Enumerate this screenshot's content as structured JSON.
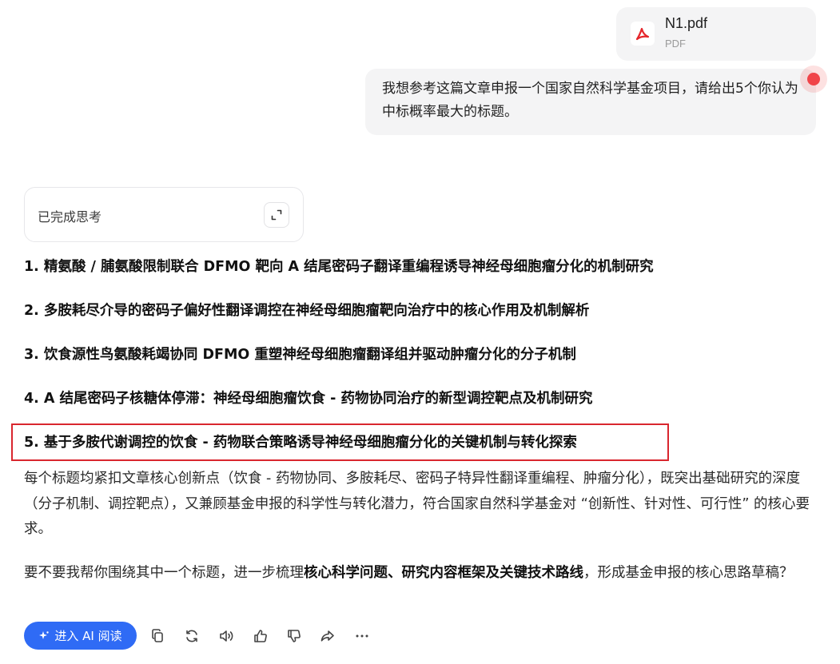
{
  "attachment": {
    "name": "N1.pdf",
    "type": "PDF",
    "icon": "pdf-icon",
    "icon_color": "#e5252a"
  },
  "user_message": {
    "text": "我想参考这篇文章申报一个国家自然科学基金项目，请给出5个你认为中标概率最大的标题。"
  },
  "thinking": {
    "label": "已完成思考",
    "expand_icon": "expand-icon"
  },
  "titles": [
    "1. 精氨酸 / 脯氨酸限制联合 DFMO 靶向 A 结尾密码子翻译重编程诱导神经母细胞瘤分化的机制研究",
    "2. 多胺耗尽介导的密码子偏好性翻译调控在神经母细胞瘤靶向治疗中的核心作用及机制解析",
    "3. 饮食源性鸟氨酸耗竭协同 DFMO 重塑神经母细胞瘤翻译组并驱动肿瘤分化的分子机制",
    "4. A 结尾密码子核糖体停滞：神经母细胞瘤饮食 - 药物协同治疗的新型调控靶点及机制研究",
    "5. 基于多胺代谢调控的饮食 - 药物联合策略诱导神经母细胞瘤分化的关键机制与转化探索"
  ],
  "summary": "每个标题均紧扣文章核心创新点（饮食 - 药物协同、多胺耗尽、密码子特异性翻译重编程、肿瘤分化），既突出基础研究的深度（分子机制、调控靶点），又兼顾基金申报的科学性与转化潜力，符合国家自然科学基金对 “创新性、针对性、可行性” 的核心要求。",
  "followup": {
    "prefix": "要不要我帮你围绕其中一个标题，进一步梳理",
    "bold": "核心科学问题、研究内容框架及关键技术路线",
    "suffix": "，形成基金申报的核心思路草稿？"
  },
  "actions": {
    "ai_read_label": "进入 AI 阅读",
    "ai_read_icon": "sparkle-icon",
    "brand_color": "#2f6bf5",
    "icons": [
      "copy-icon",
      "regenerate-icon",
      "speaker-icon",
      "thumbs-up-icon",
      "thumbs-down-icon",
      "share-icon",
      "more-icon"
    ]
  },
  "highlight_color": "#d9262e"
}
